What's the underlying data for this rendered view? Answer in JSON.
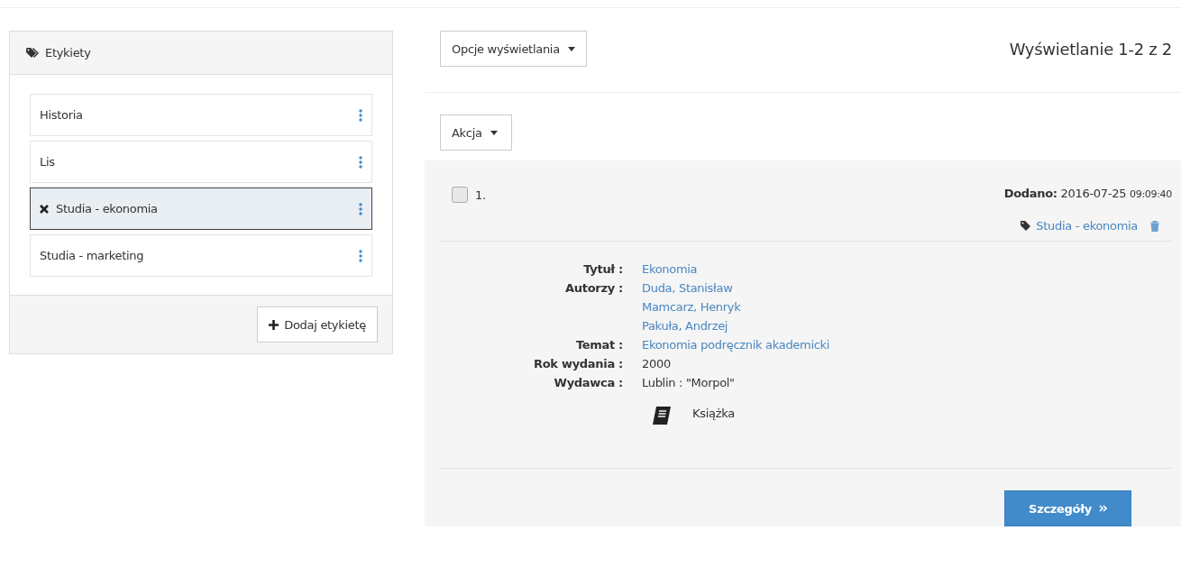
{
  "labels_panel": {
    "title": "Etykiety",
    "items": [
      {
        "name": "Historia",
        "selected": false
      },
      {
        "name": "Lis",
        "selected": false
      },
      {
        "name": "Studia - ekonomia",
        "selected": true
      },
      {
        "name": "Studia - marketing",
        "selected": false
      }
    ],
    "add_button": "Dodaj etykietę"
  },
  "toolbar": {
    "display_options": "Opcje wyświetlania",
    "summary": "Wyświetlanie 1-2 z 2",
    "action": "Akcja"
  },
  "record": {
    "number": "1.",
    "checked": false,
    "added_label": "Dodano:",
    "added_date": "2016-07-25",
    "added_time": "09:09:40",
    "tag": "Studia - ekonomia",
    "fields": [
      {
        "label": "Tytuł :",
        "kind": "link",
        "values": [
          "Ekonomia"
        ]
      },
      {
        "label": "Autorzy :",
        "kind": "link",
        "values": [
          "Duda, Stanisław",
          "Mamcarz, Henryk",
          "Pakuła, Andrzej"
        ]
      },
      {
        "label": "Temat :",
        "kind": "link",
        "values": [
          "Ekonomia podręcznik akademicki"
        ]
      },
      {
        "label": "Rok wydania :",
        "kind": "text",
        "values": [
          "2000"
        ]
      },
      {
        "label": "Wydawca :",
        "kind": "text",
        "values": [
          "Lublin : \"Morpol\""
        ]
      }
    ],
    "format": "Książka",
    "details_button": "Szczegóły"
  }
}
